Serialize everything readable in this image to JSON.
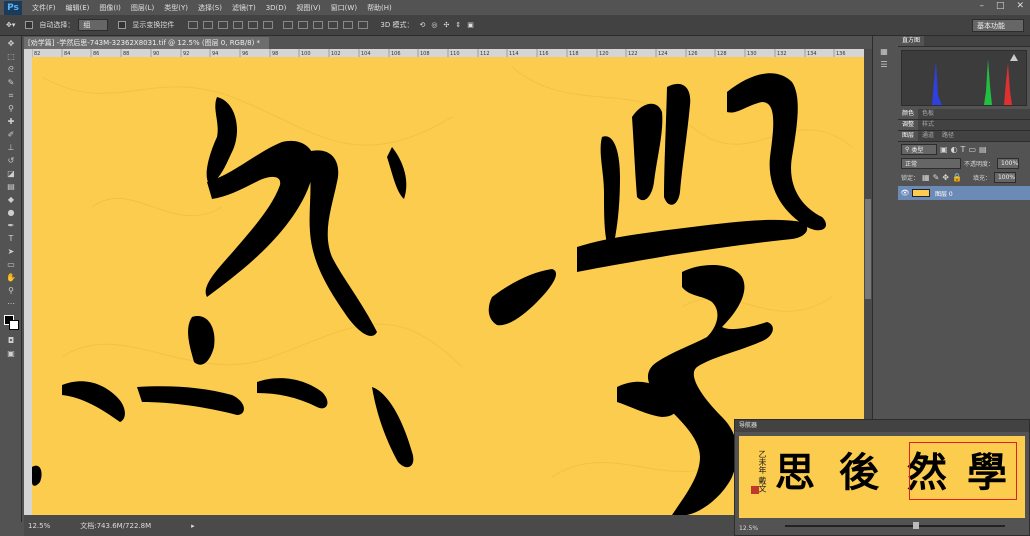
{
  "menubar": {
    "logo": "Ps",
    "items": [
      "文件(F)",
      "编辑(E)",
      "图像(I)",
      "图层(L)",
      "类型(Y)",
      "选择(S)",
      "滤镜(T)",
      "3D(D)",
      "视图(V)",
      "窗口(W)",
      "帮助(H)"
    ]
  },
  "options": {
    "auto_select_label": "自动选择：",
    "auto_select_value": "组",
    "show_transform_label": "显示变换控件",
    "mode_3d_label": "3D 模式："
  },
  "workspace": {
    "value": "基本功能"
  },
  "document": {
    "tab_title": "[劝学篇] -学然后思-743M-32362X8031.tif @ 12.5% (图层 0, RGB/8) *",
    "ruler_ticks": [
      "82",
      "84",
      "86",
      "88",
      "90",
      "92",
      "94",
      "96",
      "98",
      "100",
      "102",
      "104",
      "106",
      "108",
      "110",
      "112",
      "114",
      "116",
      "118",
      "120",
      "122",
      "124",
      "126",
      "128",
      "130",
      "132",
      "134",
      "136"
    ],
    "canvas_chars": [
      "然",
      "學"
    ],
    "canvas_color": "#fbcc4e"
  },
  "status": {
    "zoom": "12.5%",
    "doc_info": "文档:743.6M/722.8M"
  },
  "panels": {
    "histogram_title": "直方图",
    "color_tabs": [
      "颜色",
      "色板"
    ],
    "adjust_tabs": [
      "调整",
      "样式"
    ],
    "layer_tabs": [
      "图层",
      "通道",
      "路径"
    ],
    "kind_label": "类型",
    "blend_mode": "正常",
    "opacity_label": "不透明度：",
    "opacity_value": "100%",
    "lock_label": "锁定：",
    "fill_label": "填充：",
    "fill_value": "100%",
    "layer_name": "图层 0"
  },
  "navigator": {
    "title": "导航器",
    "zoom": "12.5%",
    "preview_chars": [
      "學",
      "然",
      "後",
      "思"
    ],
    "signature": "乙未年 戴文"
  },
  "colors": {
    "accent": "#6b8bb6",
    "paper": "#fbcc4e",
    "ink": "#000000",
    "nav_frame": "#e0201a"
  }
}
